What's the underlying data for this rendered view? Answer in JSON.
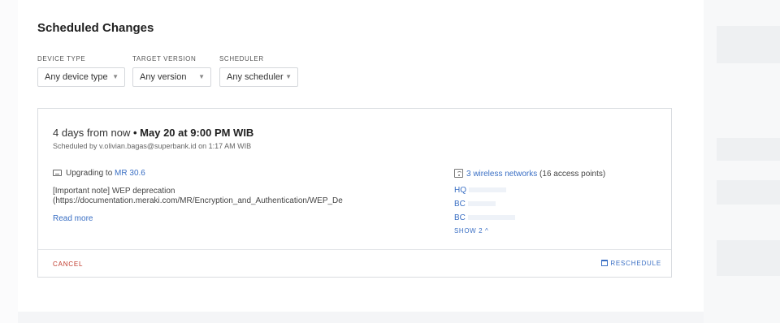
{
  "page": {
    "title": "Scheduled Changes"
  },
  "filters": [
    {
      "label": "DEVICE TYPE",
      "value": "Any device type"
    },
    {
      "label": "TARGET VERSION",
      "value": "Any version"
    },
    {
      "label": "SCHEDULER",
      "value": "Any scheduler"
    }
  ],
  "change": {
    "when_relative": "4 days from now",
    "when_absolute": "• May 20 at 9:00 PM WIB",
    "scheduled_by": "Scheduled by v.olivian.bagas@superbank.id on 1:17 AM WIB",
    "upgrade_prefix": "Upgrading to",
    "upgrade_version": "MR 30.6",
    "note_line1": "[Important note] WEP deprecation",
    "note_line2": "(https://documentation.meraki.com/MR/Encryption_and_Authentication/WEP_De",
    "read_more": "Read more",
    "networks_link": "3 wireless networks",
    "access_points": "(16 access points)",
    "networks": [
      "HQ",
      "BC",
      "BC"
    ],
    "show_more": "SHOW 2 ^",
    "cancel": "CANCEL",
    "reschedule": "RESCHEDULE"
  },
  "icons": {
    "upgrade": "device-icon",
    "wireless": "wifi-icon",
    "reschedule": "calendar-icon",
    "dropdown": "chevron-down-icon"
  },
  "colors": {
    "link": "#3a6fc4",
    "cancel": "#c0392b",
    "border": "#d9dce0"
  }
}
